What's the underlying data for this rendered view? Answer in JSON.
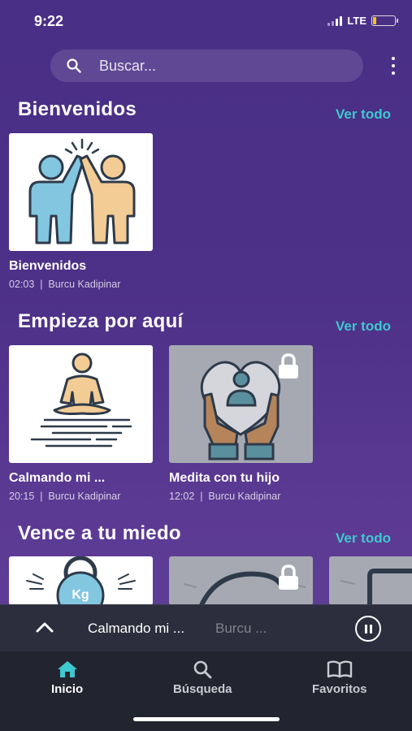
{
  "status": {
    "time": "9:22",
    "network": "LTE"
  },
  "search": {
    "placeholder": "Buscar..."
  },
  "sections": [
    {
      "title": "Bienvenidos",
      "see_all": "Ver todo",
      "items": [
        {
          "title": "Bienvenidos",
          "duration": "02:03",
          "author": "Burcu Kadipinar",
          "locked": false,
          "icon": "high-five-icon"
        }
      ]
    },
    {
      "title": "Empieza por aquí",
      "see_all": "Ver todo",
      "items": [
        {
          "title": "Calmando mi ...",
          "duration": "20:15",
          "author": "Burcu Kadipinar",
          "locked": false,
          "icon": "meditation-icon"
        },
        {
          "title": "Medita con tu hijo",
          "duration": "12:02",
          "author": "Burcu Kadipinar",
          "locked": true,
          "icon": "hands-heart-icon"
        }
      ]
    },
    {
      "title": "Vence a tu miedo",
      "see_all": "Ver todo",
      "items": [
        {
          "icon": "kettlebell-icon",
          "weight_label": "Kg",
          "locked": false
        },
        {
          "icon": "curve-icon",
          "locked": true
        },
        {
          "icon": "shape-icon",
          "locked": false
        }
      ]
    }
  ],
  "player": {
    "title": "Calmando mi ...",
    "artist": "Burcu ..."
  },
  "tabs": [
    {
      "label": "Inicio",
      "icon": "home-icon",
      "active": true
    },
    {
      "label": "Búsqueda",
      "icon": "search-icon",
      "active": false
    },
    {
      "label": "Favoritos",
      "icon": "book-icon",
      "active": false
    }
  ],
  "colors": {
    "accent": "#3ec8cf",
    "background": "#4a2f86",
    "player": "#2c2e3d",
    "tabbar": "#22242f"
  }
}
